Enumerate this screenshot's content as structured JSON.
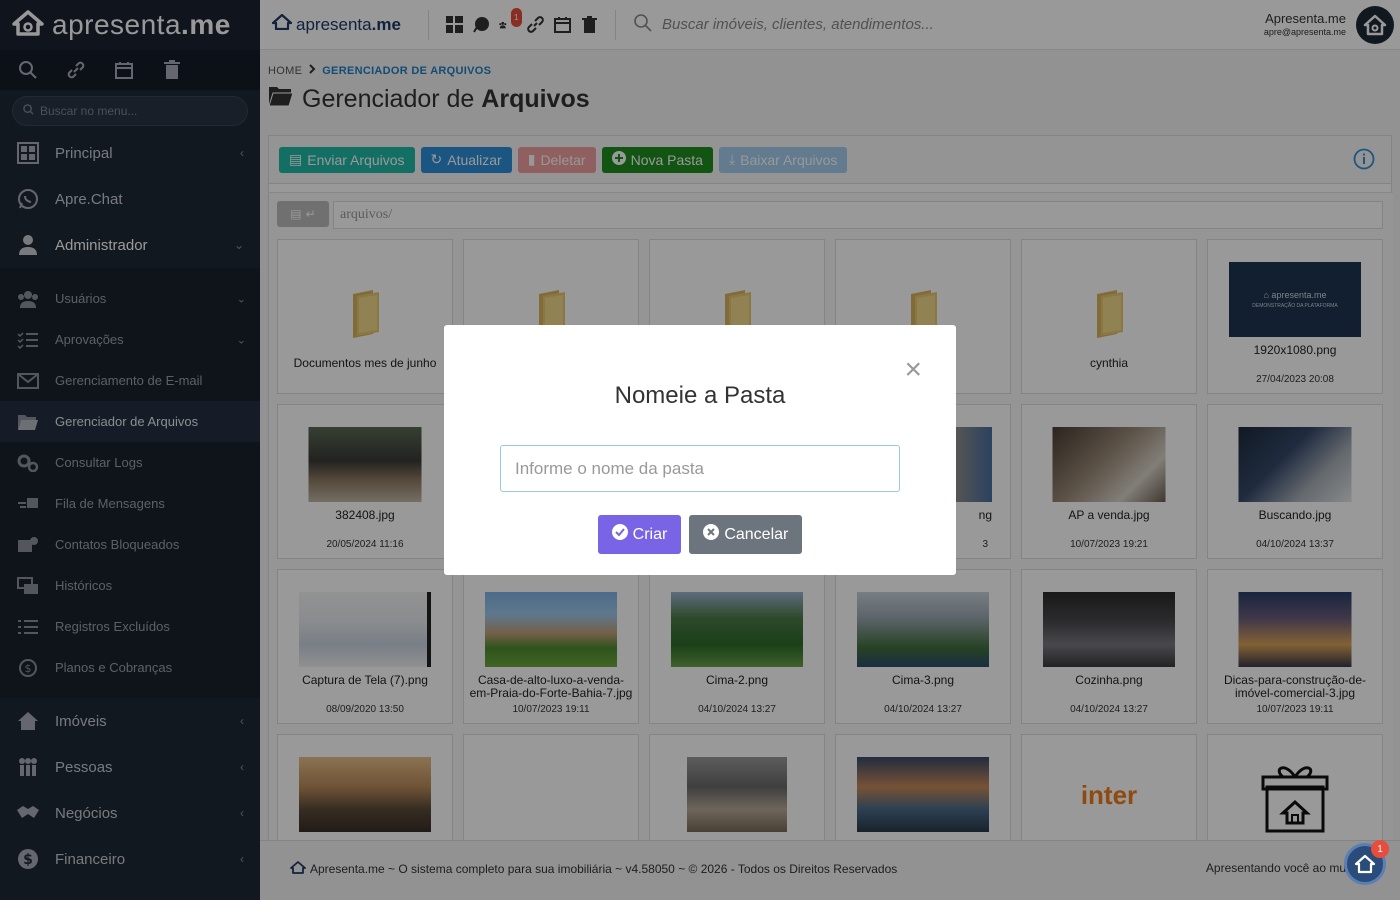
{
  "sidebar": {
    "logo_prefix": "apresenta",
    "logo_suffix": ".me",
    "search_placeholder": "Buscar no menu...",
    "items": [
      {
        "label": "Principal"
      },
      {
        "label": "Apre.Chat"
      },
      {
        "label": "Administrador"
      }
    ],
    "sub_items": [
      {
        "label": "Usuários"
      },
      {
        "label": "Aprovações"
      },
      {
        "label": "Gerenciamento de E-mail"
      },
      {
        "label": "Gerenciador de Arquivos"
      },
      {
        "label": "Consultar Logs"
      },
      {
        "label": "Fila de Mensagens"
      },
      {
        "label": "Contatos Bloqueados"
      },
      {
        "label": "Históricos"
      },
      {
        "label": "Registros Excluídos"
      },
      {
        "label": "Planos e Cobranças"
      }
    ],
    "bottom_items": [
      {
        "label": "Imóveis"
      },
      {
        "label": "Pessoas"
      },
      {
        "label": "Negócios"
      },
      {
        "label": "Financeiro"
      }
    ]
  },
  "topbar": {
    "logo_prefix": "apresenta",
    "logo_suffix": ".me",
    "notification_count": "1",
    "search_placeholder": "Buscar imóveis, clientes, atendimentos...",
    "user_name": "Apresenta.me",
    "user_email": "apre@apresenta.me"
  },
  "breadcrumb": {
    "home": "HOME",
    "current": "GERENCIADOR DE ARQUIVOS"
  },
  "page_title": {
    "prefix": "Gerenciador de ",
    "bold": "Arquivos"
  },
  "toolbar": {
    "upload": "Enviar Arquivos",
    "refresh": "Atualizar",
    "delete": "Deletar",
    "new_folder": "Nova Pasta",
    "download": "Baixar Arquivos"
  },
  "path": {
    "back_label": "↵",
    "current": "arquivos/"
  },
  "files": [
    {
      "name": "Documentos mes de junho",
      "date": ""
    },
    {
      "name": "",
      "date": ""
    },
    {
      "name": "",
      "date": ""
    },
    {
      "name": "",
      "date": ""
    },
    {
      "name": "cynthia",
      "date": ""
    },
    {
      "name": "1920x1080.png",
      "date": "27/04/2023 20:08"
    },
    {
      "name": "382408.jpg",
      "date": "20/05/2024 11:16"
    },
    {
      "name": "",
      "date": ""
    },
    {
      "name": "",
      "date": ""
    },
    {
      "name": "ng",
      "date": "3"
    },
    {
      "name": "AP a venda.jpg",
      "date": "10/07/2023 19:21"
    },
    {
      "name": "Buscando.jpg",
      "date": "04/10/2024 13:37"
    },
    {
      "name": "Captura de Tela (7).png",
      "date": "08/09/2020 13:50"
    },
    {
      "name": "Casa-de-alto-luxo-a-venda-em-Praia-do-Forte-Bahia-7.jpg",
      "date": "10/07/2023 19:11"
    },
    {
      "name": "Cima-2.png",
      "date": "04/10/2024 13:27"
    },
    {
      "name": "Cima-3.png",
      "date": "04/10/2024 13:27"
    },
    {
      "name": "Cozinha.png",
      "date": "04/10/2024 13:27"
    },
    {
      "name": "Dicas-para-construção-de-imóvel-comercial-3.jpg",
      "date": "10/07/2023 19:11"
    }
  ],
  "thumb_caption_1920": "DEMONSTRAÇÃO DA PLATAFORMA",
  "thumb_inter": "inter",
  "modal": {
    "title": "Nomeie a Pasta",
    "input_placeholder": "Informe o nome da pasta",
    "create": "Criar",
    "cancel": "Cancelar"
  },
  "footer": {
    "left": "Apresenta.me ~ O sistema completo para sua imobiliária ~ v4.58050 ~ © 2026 - Todos os Direitos Reservados",
    "right": "Apresentando você ao mu",
    "chat_badge": "1"
  },
  "colors": {
    "sidebar_bg": "#1f2836",
    "accent_blue": "#1f7fc2",
    "btn_teal": "#20b7a7",
    "btn_green": "#1f8c1f",
    "btn_purple": "#7a64e6"
  }
}
